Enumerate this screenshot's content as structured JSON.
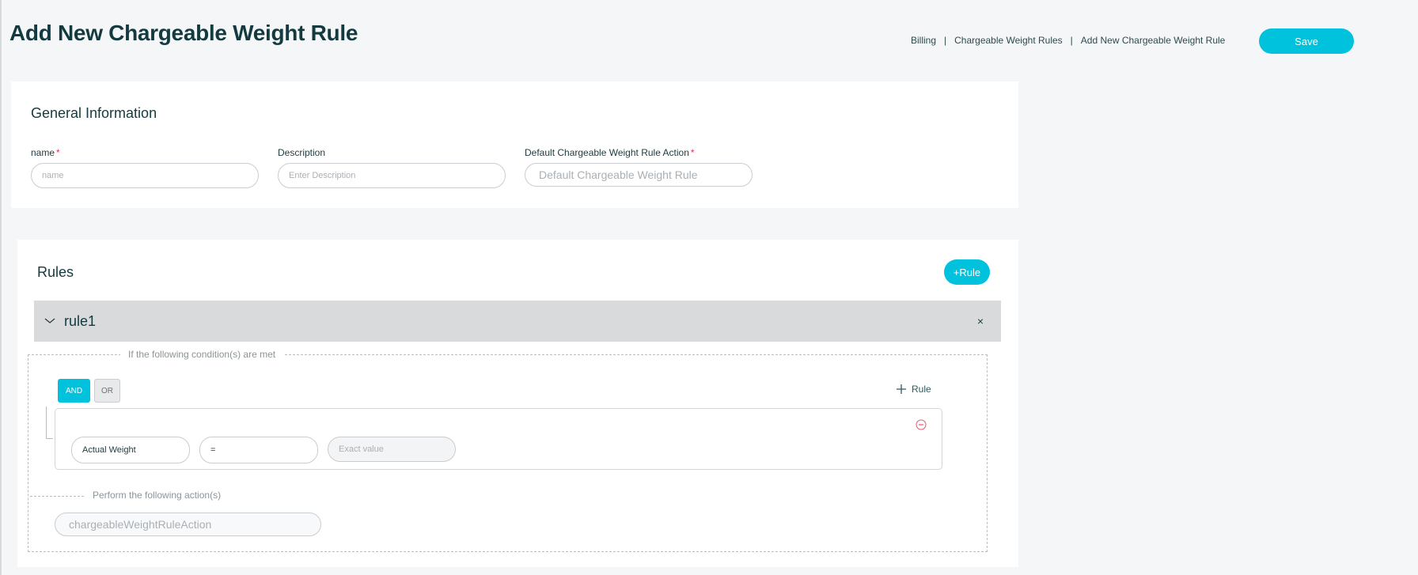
{
  "page": {
    "title": "Add New Chargeable Weight Rule"
  },
  "breadcrumb": {
    "items": [
      "Billing",
      "Chargeable Weight Rules",
      "Add New Chargeable Weight Rule"
    ],
    "separator": "|"
  },
  "toolbar": {
    "save_label": "Save"
  },
  "general": {
    "title": "General Information",
    "name_label": "name",
    "name_placeholder": "name",
    "description_label": "Description",
    "description_placeholder": "Enter Description",
    "default_action_label": "Default Chargeable Weight Rule Action",
    "default_action_placeholder": "Default Chargeable Weight Rule",
    "required_mark": "*"
  },
  "rules": {
    "title": "Rules",
    "add_rule_label": "+Rule",
    "rule": {
      "name": "rule1",
      "close_symbol": "×",
      "condition_legend": "If the following condition(s) are met",
      "and_label": "AND",
      "or_label": "OR",
      "add_condition_label": "Rule",
      "condition": {
        "field_value": "Actual Weight",
        "operator_value": "=",
        "value_placeholder": "Exact value"
      },
      "action_legend": "Perform the following action(s)",
      "action_placeholder": "chargeableWeightRuleAction"
    }
  },
  "colors": {
    "accent": "#00c2dd",
    "required": "#e0324b",
    "remove": "#e05a6a"
  }
}
